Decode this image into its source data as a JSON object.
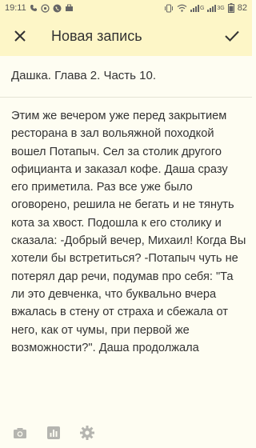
{
  "status_bar": {
    "time": "19:11",
    "signal_1_label": "G",
    "signal_2_label": "3G",
    "battery": "82"
  },
  "app_bar": {
    "title": "Новая запись",
    "close_icon": "close-icon",
    "confirm_icon": "check-icon"
  },
  "entry": {
    "title": "Дашка. Глава 2. Часть 10.",
    "body": "Этим же вечером уже перед закрытием ресторана в зал вольяжной походкой вошел Потапыч. Сел за столик другого официанта и заказал кофе. Даша сразу его приметила. Раз все уже было оговорено, решила не бегать и не тянуть кота за хвост. Подошла к его столику и сказала: -Добрый вечер, Михаил! Когда Вы хотели бы встретиться? -Потапыч чуть не потерял дар речи, подумав про себя: \"Та ли это девченка, что буквально вчера вжалась в стену от страха и сбежала от него, как от чумы, при первой же возможности?\". Даша продолжала"
  },
  "toolbar": {
    "icons": [
      "camera-icon",
      "chart-icon",
      "gear-icon"
    ]
  },
  "colors": {
    "header_bg": "#fdf6c7",
    "page_bg": "#fefdf2",
    "text": "#333333",
    "icon_gray": "#b5b5b0"
  }
}
